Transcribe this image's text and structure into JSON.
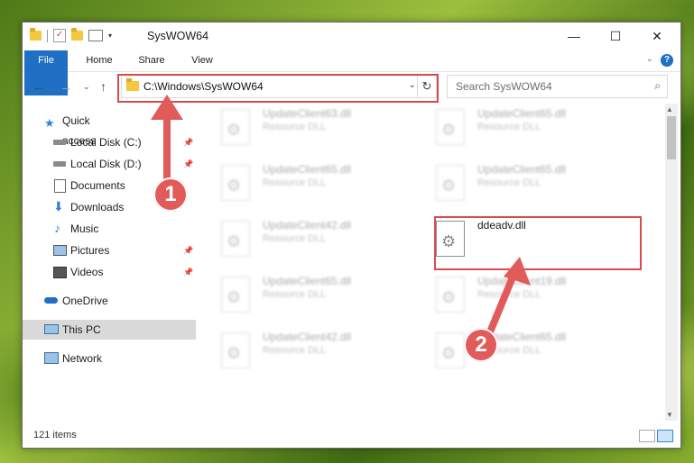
{
  "window": {
    "title": "SysWOW64"
  },
  "window_controls": {
    "minimize": "—",
    "maximize": "☐",
    "close": "✕"
  },
  "ribbon": {
    "tabs": [
      "File",
      "Home",
      "Share",
      "View"
    ],
    "help": "?"
  },
  "address": {
    "path": "C:\\Windows\\SysWOW64"
  },
  "search": {
    "placeholder": "Search SysWOW64"
  },
  "sidebar": {
    "items": [
      {
        "label": "Quick access"
      },
      {
        "label": "Local Disk (C:)"
      },
      {
        "label": "Local Disk (D:)"
      },
      {
        "label": "Documents"
      },
      {
        "label": "Downloads"
      },
      {
        "label": "Music"
      },
      {
        "label": "Pictures"
      },
      {
        "label": "Videos"
      },
      {
        "label": "OneDrive"
      },
      {
        "label": "This PC"
      },
      {
        "label": "Network"
      }
    ]
  },
  "files": [
    {
      "name": "UpdateClient63.dll",
      "type": "Resource DLL"
    },
    {
      "name": "UpdateClient65.dll",
      "type": "Resource DLL"
    },
    {
      "name": "UpdateClient65.dll",
      "type": "Resource DLL"
    },
    {
      "name": "UpdateClient65.dll",
      "type": "Resource DLL"
    },
    {
      "name": "UpdateClient42.dll",
      "type": "Resource DLL"
    },
    {
      "name": "ddeadv.dll",
      "type": ""
    },
    {
      "name": "UpdateClient65.dll",
      "type": "Resource DLL"
    },
    {
      "name": "UpdateClient19.dll",
      "type": "Resource DLL"
    },
    {
      "name": "UpdateClient42.dll",
      "type": "Resource DLL"
    },
    {
      "name": "UpdateClient65.dll",
      "type": "Resource DLL"
    }
  ],
  "status": {
    "items": "121 items"
  },
  "annotations": {
    "badge1": "1",
    "badge2": "2"
  },
  "colors": {
    "accent": "#1f6fc5",
    "highlight": "#d94b4b"
  }
}
